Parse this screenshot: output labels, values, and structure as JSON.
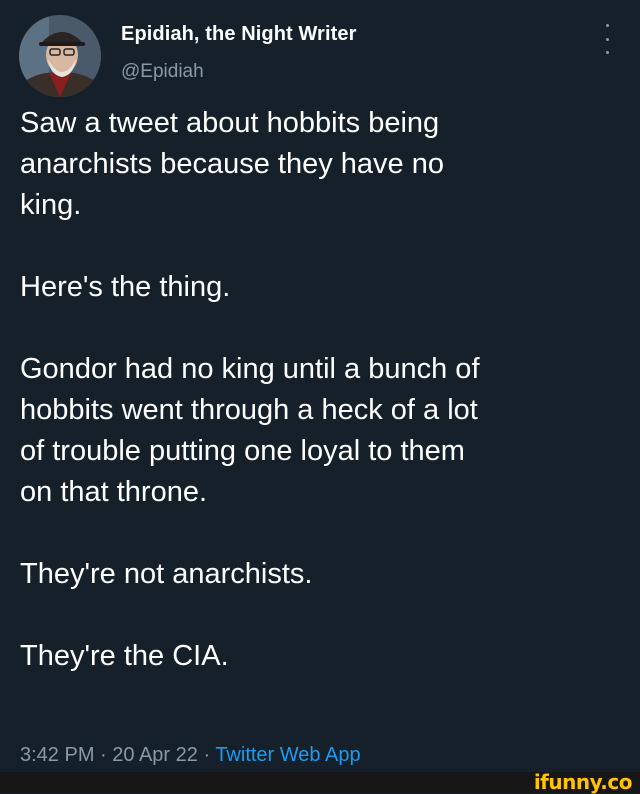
{
  "author": {
    "name": "Epidiah, the Night Writer",
    "handle": "@Epidiah",
    "avatar_icon": "profile-photo"
  },
  "more_icon": "more-options-icon",
  "tweet": {
    "paragraphs": [
      "Saw a tweet about hobbits being\nanarchists because they have no\nking.",
      "Here's the thing.",
      "Gondor had no king until a bunch of\nhobbits went through a heck of a lot\nof trouble putting one loyal to them\non that throne.",
      "They're not anarchists.",
      "They're the CIA."
    ]
  },
  "meta": {
    "time": "3:42 PM",
    "separator": " · ",
    "date": "20 Apr 22",
    "source": "Twitter Web App"
  },
  "watermark": "ifunny.co",
  "colors": {
    "background": "#15202b",
    "text": "#ffffff",
    "secondary": "#8b98a5",
    "link": "#1d9bf0",
    "watermark": "#ffc300"
  }
}
